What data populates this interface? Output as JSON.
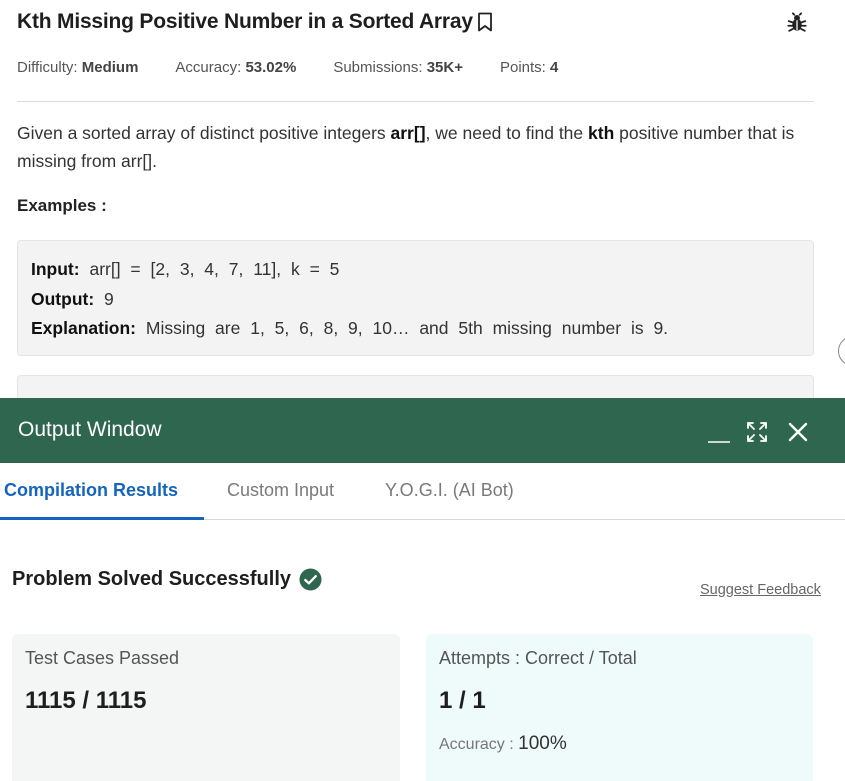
{
  "problem": {
    "title": "Kth Missing Positive Number in a Sorted Array",
    "meta": {
      "difficulty_label": "Difficulty:",
      "difficulty_value": "Medium",
      "accuracy_label": "Accuracy:",
      "accuracy_value": "53.02%",
      "submissions_label": "Submissions:",
      "submissions_value": "35K+",
      "points_label": "Points:",
      "points_value": "4"
    },
    "description": {
      "part1": "Given a sorted array of distinct positive integers ",
      "bold1": "arr[]",
      "part2": ", we need to find the ",
      "bold2": "kth",
      "part3": " positive number that is missing from arr[]."
    },
    "examples_heading": "Examples :",
    "example1": {
      "input_label": "Input:",
      "input_value": " arr[] = [2, 3, 4, 7, 11], k = 5",
      "output_label": "Output:",
      "output_value": " 9",
      "explanation_label": "Explanation:",
      "explanation_value": " Missing are 1, 5, 6, 8, 9, 10… and 5th missing number is 9."
    }
  },
  "output_window": {
    "title": "Output Window",
    "tabs": [
      {
        "label": "Compilation Results",
        "active": true
      },
      {
        "label": "Custom Input",
        "active": false
      },
      {
        "label": "Y.O.G.I. (AI Bot)",
        "active": false
      }
    ],
    "status": "Problem Solved Successfully",
    "suggest_feedback": "Suggest Feedback",
    "test_cases": {
      "label": "Test Cases Passed",
      "value": "1115 / 1115"
    },
    "attempts": {
      "label": "Attempts : Correct / Total",
      "value": "1 / 1",
      "accuracy_label": "Accuracy : ",
      "accuracy_value": "100%"
    }
  },
  "colors": {
    "header_green": "#2e6650",
    "active_tab_blue": "#1565c0",
    "success_green": "#2e6650"
  },
  "icons": {
    "bookmark": "bookmark-icon",
    "bug": "bug-icon",
    "minimize": "minimize-icon",
    "maximize": "maximize-icon",
    "close": "close-icon",
    "check": "check-circle-icon"
  }
}
